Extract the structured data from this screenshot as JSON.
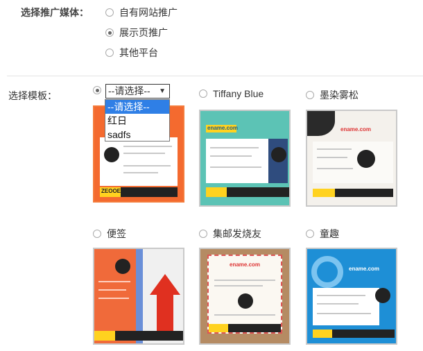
{
  "media": {
    "label": "选择推广媒体：",
    "options": [
      {
        "label": "自有网站推广",
        "checked": false
      },
      {
        "label": "展示页推广",
        "checked": true
      },
      {
        "label": "其他平台",
        "checked": false
      }
    ]
  },
  "template": {
    "label": "选择模板：",
    "select": {
      "value": "--请选择--",
      "options": [
        "--请选择--",
        "红日",
        "sadfs"
      ]
    },
    "items": [
      {
        "label": "",
        "checked": true
      },
      {
        "label": "Tiffany Blue",
        "checked": false
      },
      {
        "label": "墨染雾松",
        "checked": false
      },
      {
        "label": "便签",
        "checked": false
      },
      {
        "label": "集邮发烧友",
        "checked": false
      },
      {
        "label": "童趣",
        "checked": false
      }
    ],
    "thumb_text": {
      "domain": "ename.com",
      "brand": "ZEOOE"
    }
  },
  "colors": {
    "orange": "#f46a2f",
    "tiffany": "#5cc3b5",
    "blue_kids": "#1e8fd6",
    "highlight": "#2f7fe6"
  }
}
